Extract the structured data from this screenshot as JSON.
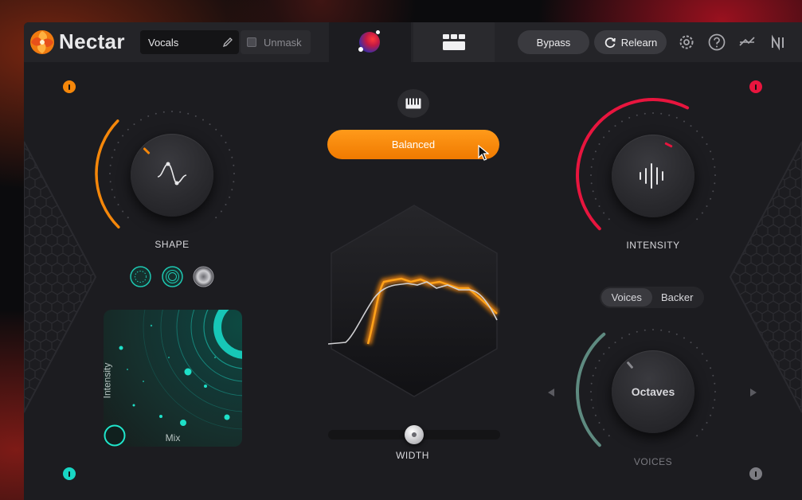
{
  "header": {
    "brand": "Nectar",
    "preset_name": "Vocals",
    "unmask_label": "Unmask",
    "bypass_label": "Bypass",
    "relearn_label": "Relearn"
  },
  "center": {
    "mode_label": "Balanced",
    "width_label": "WIDTH",
    "width_value": 0.5
  },
  "shape": {
    "label": "SHAPE",
    "value": 0.33
  },
  "intensity": {
    "label": "INTENSITY",
    "value": 0.6
  },
  "pad": {
    "x_label": "Mix",
    "y_label": "Intensity"
  },
  "voices": {
    "tabs": [
      "Voices",
      "Backer"
    ],
    "active_tab": "Voices",
    "knob_label": "Octaves",
    "label": "VOICES",
    "value": 0.35
  },
  "colors": {
    "accent_orange": "#f5870a",
    "accent_red": "#e8153e",
    "accent_teal": "#18d6c4",
    "accent_grey": "#8a8a8f"
  }
}
